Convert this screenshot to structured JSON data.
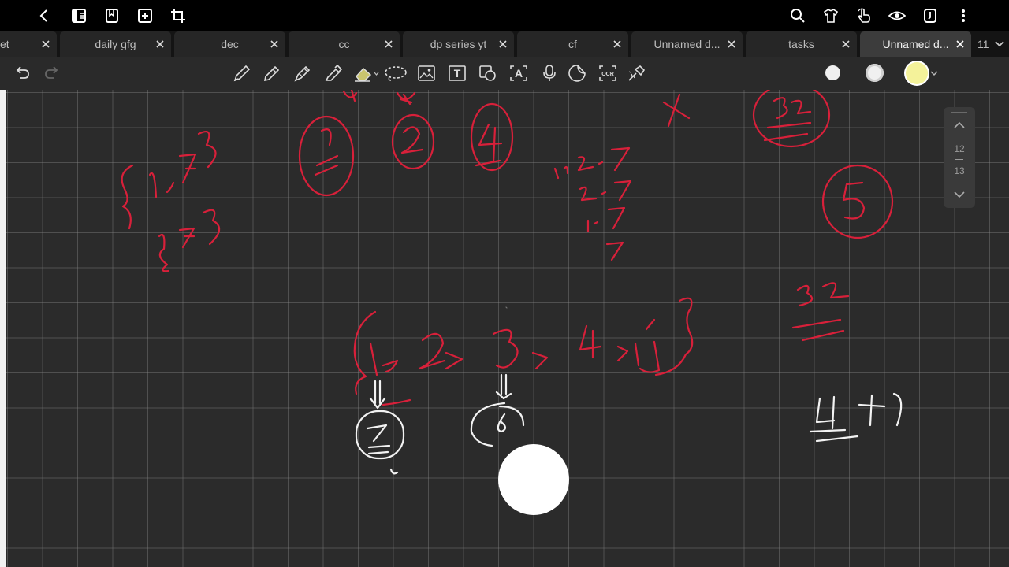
{
  "tabs": [
    {
      "label": "et",
      "active": false
    },
    {
      "label": "daily gfg",
      "active": false
    },
    {
      "label": "dec",
      "active": false
    },
    {
      "label": "cc",
      "active": false
    },
    {
      "label": "dp series yt",
      "active": false
    },
    {
      "label": "cf",
      "active": false
    },
    {
      "label": "Unnamed d...",
      "active": false
    },
    {
      "label": "tasks",
      "active": false
    },
    {
      "label": "Unnamed d...",
      "active": true
    }
  ],
  "tab_overflow_count": "11",
  "topbar_icons": [
    "back-icon",
    "sidebar-icon",
    "bookmark-icon",
    "add-page-icon",
    "crop-icon",
    "search-icon",
    "shirt-icon",
    "touch-icon",
    "eye-icon",
    "page-settings-icon",
    "more-icon"
  ],
  "toolbar_icons": [
    "undo-icon",
    "redo-icon",
    "fountain-pen-icon",
    "pencil-icon",
    "pen-icon",
    "marker-icon",
    "eraser-icon",
    "lasso-icon",
    "image-icon",
    "text-icon",
    "shape-icon",
    "text-box-icon",
    "microphone-icon",
    "sticker-icon",
    "ocr-icon",
    "laser-pointer-icon"
  ],
  "ocr_label": "OCR",
  "text_tool_label": "T",
  "textbox_tool_label": "A",
  "colors": {
    "ink_red": "#d8203a",
    "ink_white": "#f2f2f2",
    "swatch_1": "#f0f0f0",
    "swatch_2": "#f0f0f0",
    "swatch_3_selected": "#f4f29a",
    "canvas_bg": "#2b2b2b"
  },
  "pager": {
    "current": "12",
    "total": "13"
  }
}
